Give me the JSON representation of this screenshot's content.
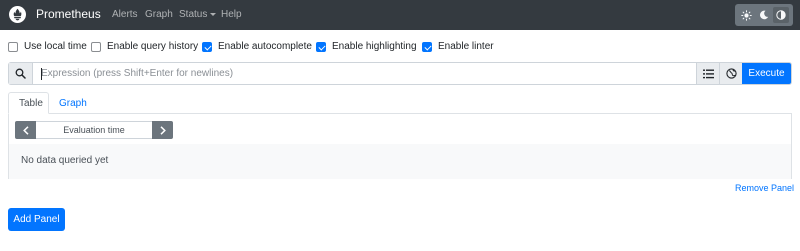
{
  "navbar": {
    "brand": "Prometheus",
    "links": [
      {
        "label": "Alerts"
      },
      {
        "label": "Graph"
      },
      {
        "label": "Status"
      },
      {
        "label": "Help"
      }
    ],
    "theme_icons": [
      "sun-icon",
      "moon-icon",
      "contrast-icon"
    ]
  },
  "options": {
    "local_time": {
      "label": "Use local time",
      "checked": false
    },
    "query_history": {
      "label": "Enable query history",
      "checked": false
    },
    "autocomplete": {
      "label": "Enable autocomplete",
      "checked": true
    },
    "highlighting": {
      "label": "Enable highlighting",
      "checked": true
    },
    "linter": {
      "label": "Enable linter",
      "checked": true
    }
  },
  "expression": {
    "value": "",
    "placeholder": "Expression (press Shift+Enter for newlines)",
    "execute_label": "Execute"
  },
  "tabs": [
    {
      "label": "Table",
      "active": true
    },
    {
      "label": "Graph",
      "active": false
    }
  ],
  "panel": {
    "eval_time_placeholder": "Evaluation time",
    "no_data": "No data queried yet",
    "remove_label": "Remove Panel"
  },
  "add_panel_label": "Add Panel",
  "colors": {
    "navbar": "#343a40",
    "primary": "#0275ff",
    "secondary": "#6c757d"
  }
}
